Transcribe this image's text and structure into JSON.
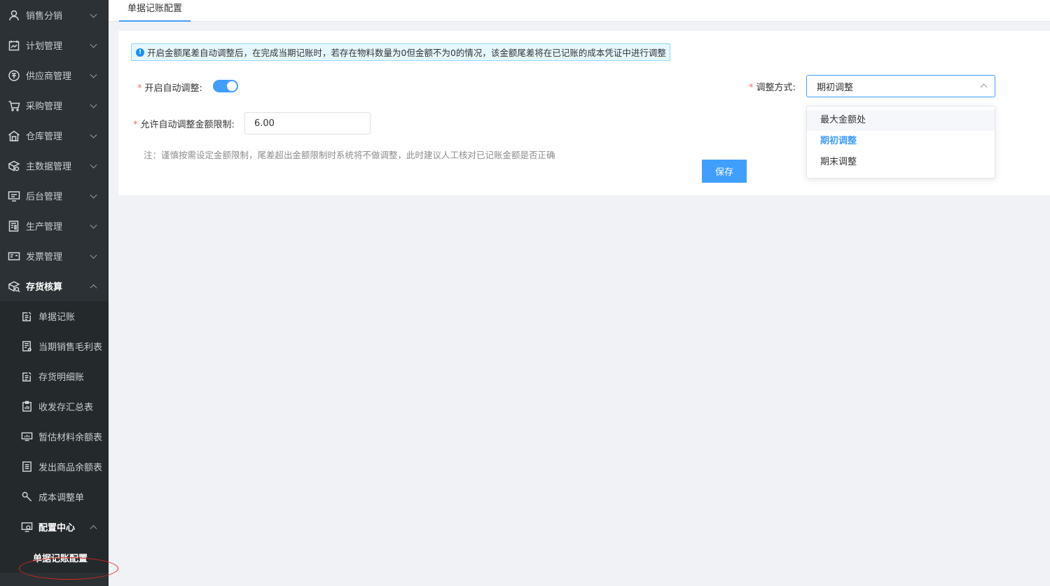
{
  "sidebar": {
    "items": [
      {
        "label": "销售分销",
        "icon": "user-icon"
      },
      {
        "label": "计划管理",
        "icon": "plan-icon"
      },
      {
        "label": "供应商管理",
        "icon": "supplier-icon"
      },
      {
        "label": "采购管理",
        "icon": "cart-icon"
      },
      {
        "label": "仓库管理",
        "icon": "warehouse-icon"
      },
      {
        "label": "主数据管理",
        "icon": "data-icon"
      },
      {
        "label": "后台管理",
        "icon": "admin-icon"
      },
      {
        "label": "生产管理",
        "icon": "production-icon"
      },
      {
        "label": "发票管理",
        "icon": "invoice-icon"
      }
    ],
    "open_item": {
      "label": "存货核算",
      "icon": "inventory-icon"
    },
    "subitems": [
      {
        "label": "单据记账"
      },
      {
        "label": "当期销售毛利表"
      },
      {
        "label": "存货明细账"
      },
      {
        "label": "收发存汇总表"
      },
      {
        "label": "暂估材料余额表"
      },
      {
        "label": "发出商品余额表"
      },
      {
        "label": "成本调整单"
      }
    ],
    "config_center": {
      "label": "配置中心"
    },
    "active_leaf": {
      "label": "单据记账配置"
    }
  },
  "tabs": [
    {
      "label": "单据记账配置"
    }
  ],
  "form": {
    "notice": "开启金额尾差自动调整后，在完成当期记账时，若存在物料数量为0但金额不为0的情况，该金额尾差将在已记账的成本凭证中进行调整",
    "auto_adjust_label": "开启自动调整:",
    "auto_adjust_on": true,
    "limit_label": "允许自动调整金额限制:",
    "limit_value": "6.00",
    "note": "注：谨慎按需设定金额限制，尾差超出金额限制时系统将不做调整，此时建议人工核对已记账金额是否正确",
    "save_label": "保存",
    "method_label": "调整方式:",
    "method_value": "期初调整",
    "required_mark": "*",
    "method_options": [
      "最大金额处",
      "期初调整",
      "期末调整"
    ]
  },
  "colors": {
    "primary": "#409eff",
    "sidebar_bg": "#2b3134",
    "required": "#f56c6c",
    "highlight": "#d9261c"
  }
}
